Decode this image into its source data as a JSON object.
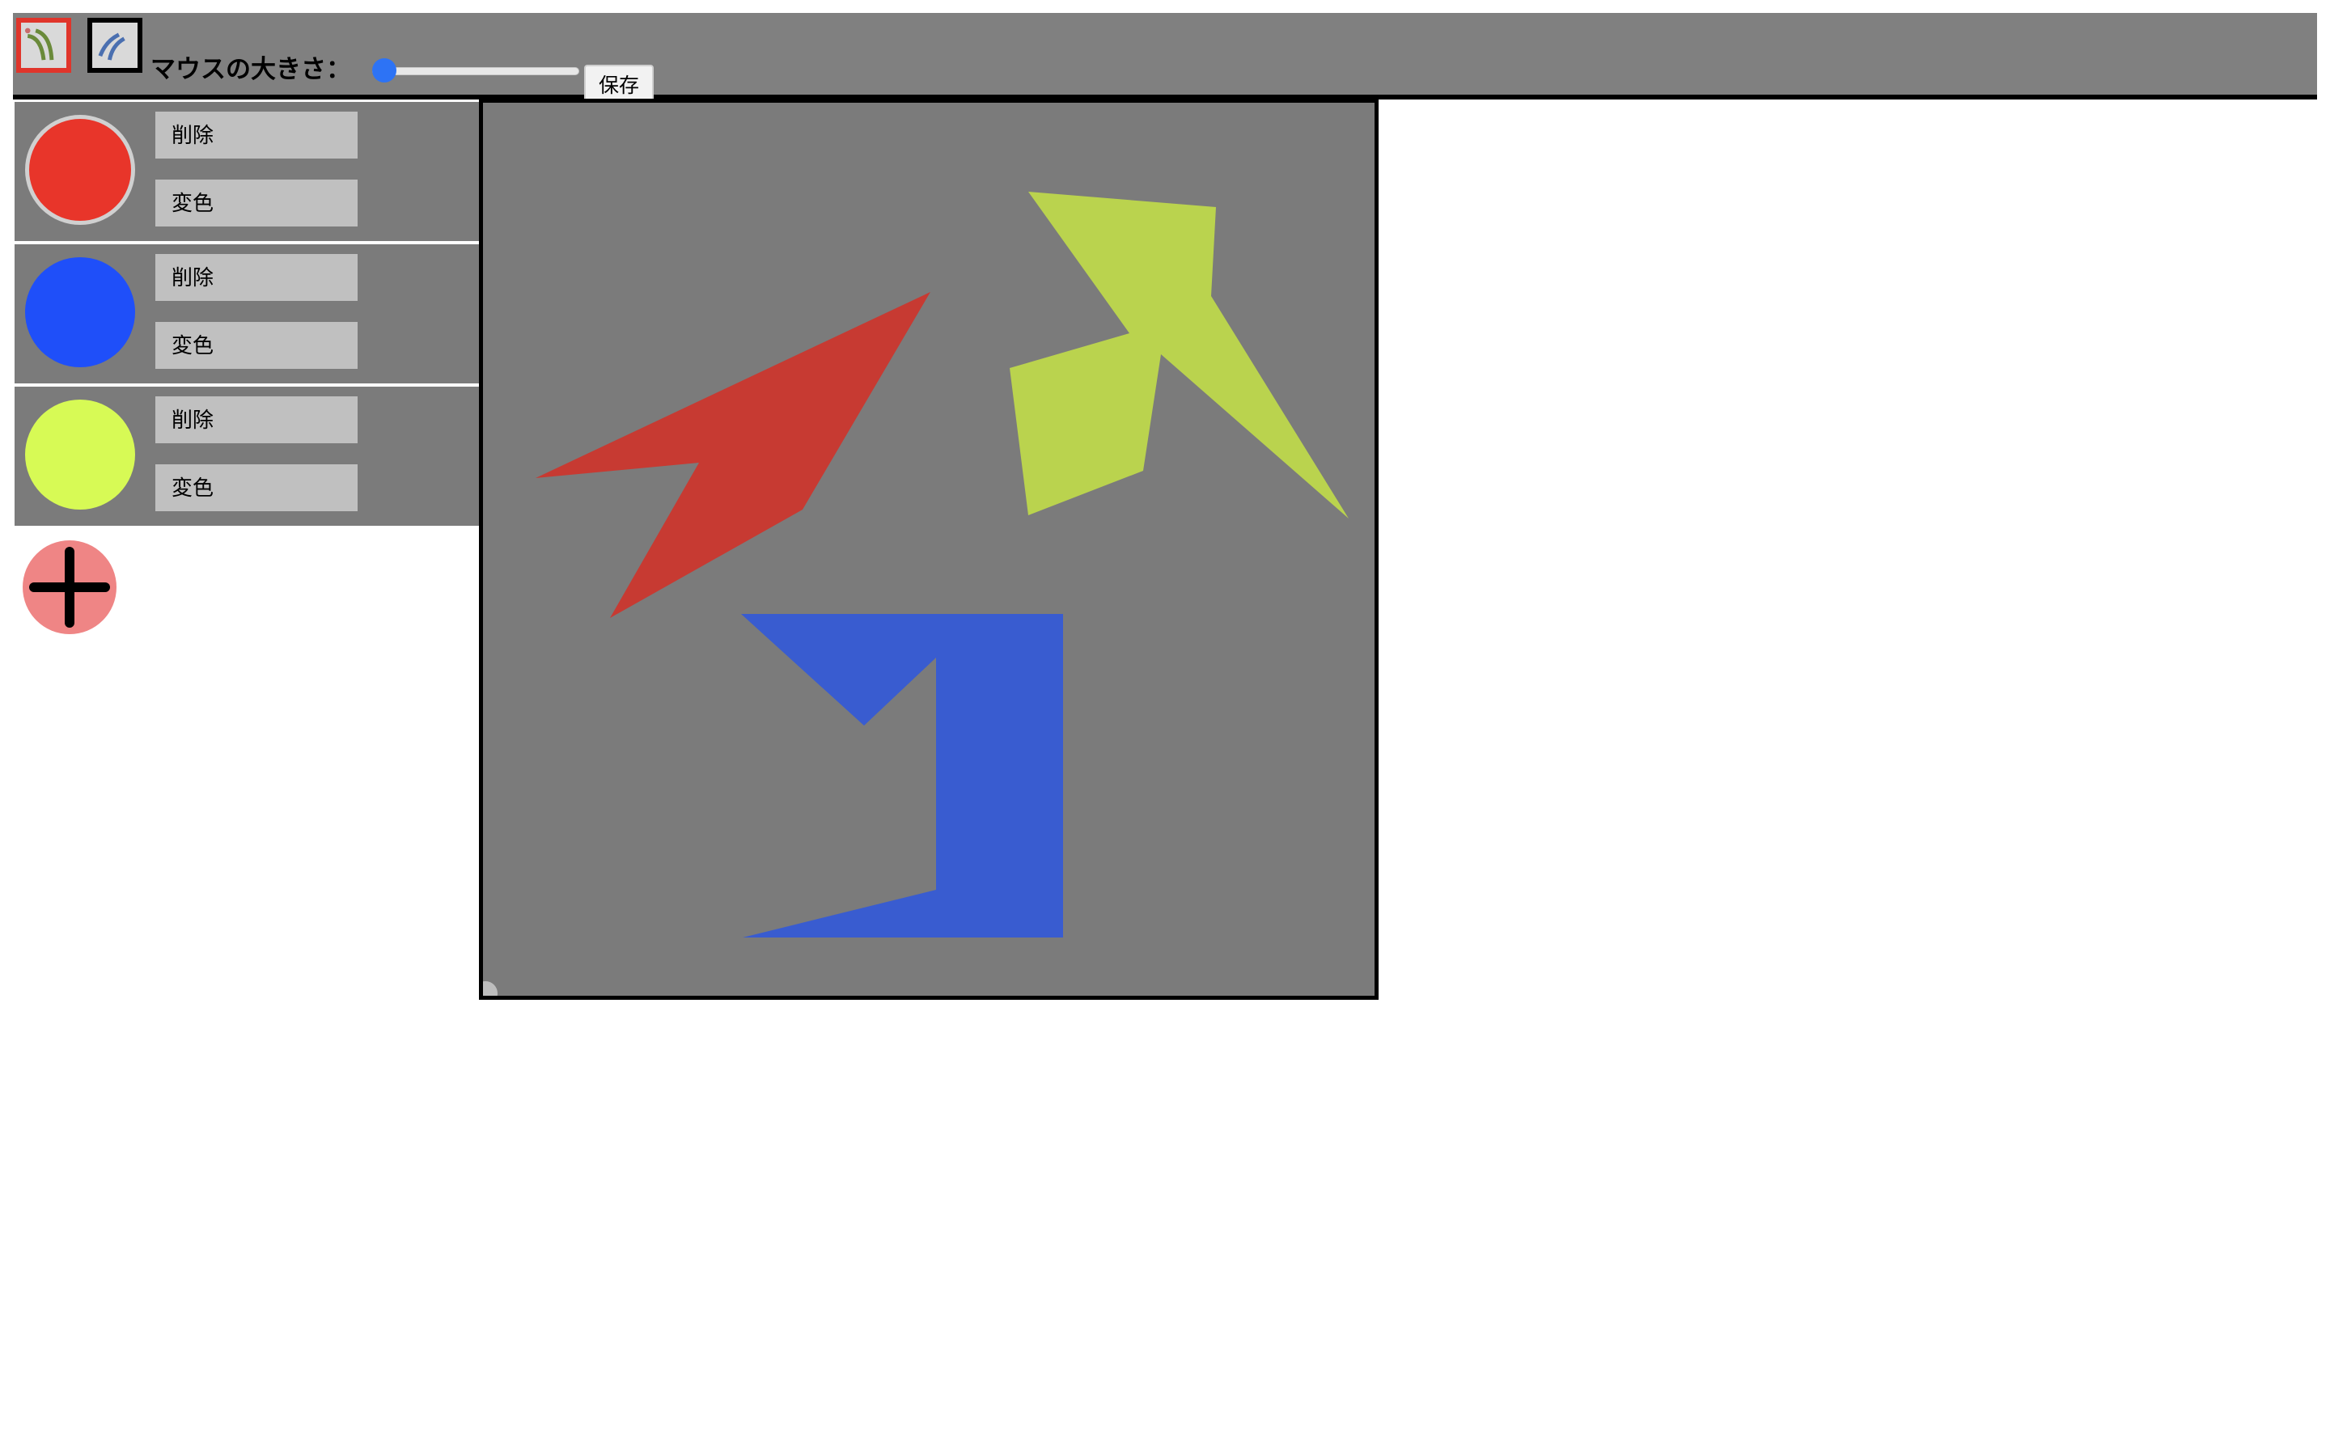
{
  "toolbar": {
    "tools": [
      {
        "name": "pen-tool",
        "selected": true,
        "icon": "pen-stroke-icon"
      },
      {
        "name": "curve-tool",
        "selected": false,
        "icon": "curve-stroke-icon"
      }
    ],
    "mouse_size_label": "マウスの大きさ：",
    "mouse_size_value": 0,
    "save_label": "保存"
  },
  "colors": [
    {
      "color": "#e8352a",
      "active": true,
      "delete_label": "削除",
      "change_label": "変色"
    },
    {
      "color": "#1f4ff9",
      "active": false,
      "delete_label": "削除",
      "change_label": "変色"
    },
    {
      "color": "#d7fa55",
      "active": false,
      "delete_label": "削除",
      "change_label": "変色"
    }
  ],
  "add_button": {
    "icon": "plus-icon",
    "color": "#ef8585"
  },
  "canvas": {
    "background": "#7b7b7b",
    "shapes": [
      {
        "name": "red-shape",
        "color": "#c73a32"
      },
      {
        "name": "green-shape",
        "color": "#bad34e"
      },
      {
        "name": "blue-shape",
        "color": "#395cd0"
      }
    ]
  }
}
